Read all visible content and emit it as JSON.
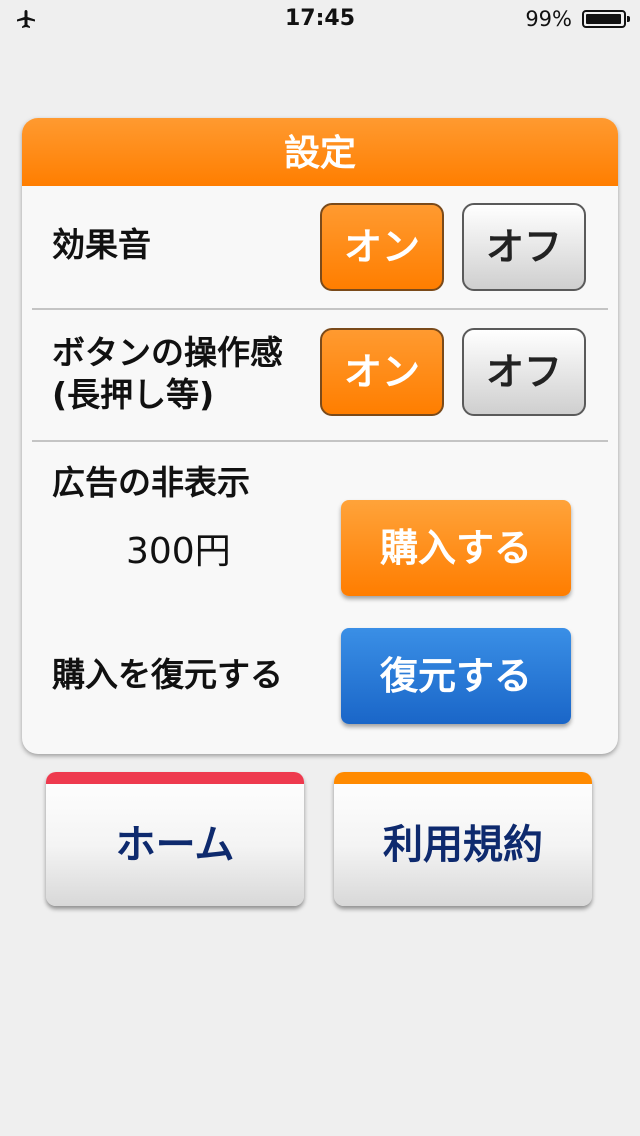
{
  "status_bar": {
    "time": "17:45",
    "battery_text": "99%",
    "battery_level": 0.99,
    "icon": "airplane-icon"
  },
  "settings": {
    "title": "設定",
    "sound_effects": {
      "label": "効果音",
      "on_label": "オン",
      "off_label": "オフ",
      "selected": "on"
    },
    "button_feel": {
      "label_line1": "ボタンの操作感",
      "label_line2": "(長押し等)",
      "on_label": "オン",
      "off_label": "オフ",
      "selected": "on"
    },
    "remove_ads": {
      "label": "広告の非表示",
      "price": "300円",
      "buy_label": "購入する"
    },
    "restore": {
      "label": "購入を復元する",
      "button_label": "復元する"
    }
  },
  "nav": {
    "home_label": "ホーム",
    "terms_label": "利用規約",
    "colors": {
      "home_strip": "#ee3a4e",
      "terms_strip": "#ff8a00",
      "label": "#0e2a6e"
    }
  },
  "colors": {
    "accent_orange": "#ff7e00",
    "accent_blue": "#1a66c8",
    "background": "#efefef"
  }
}
